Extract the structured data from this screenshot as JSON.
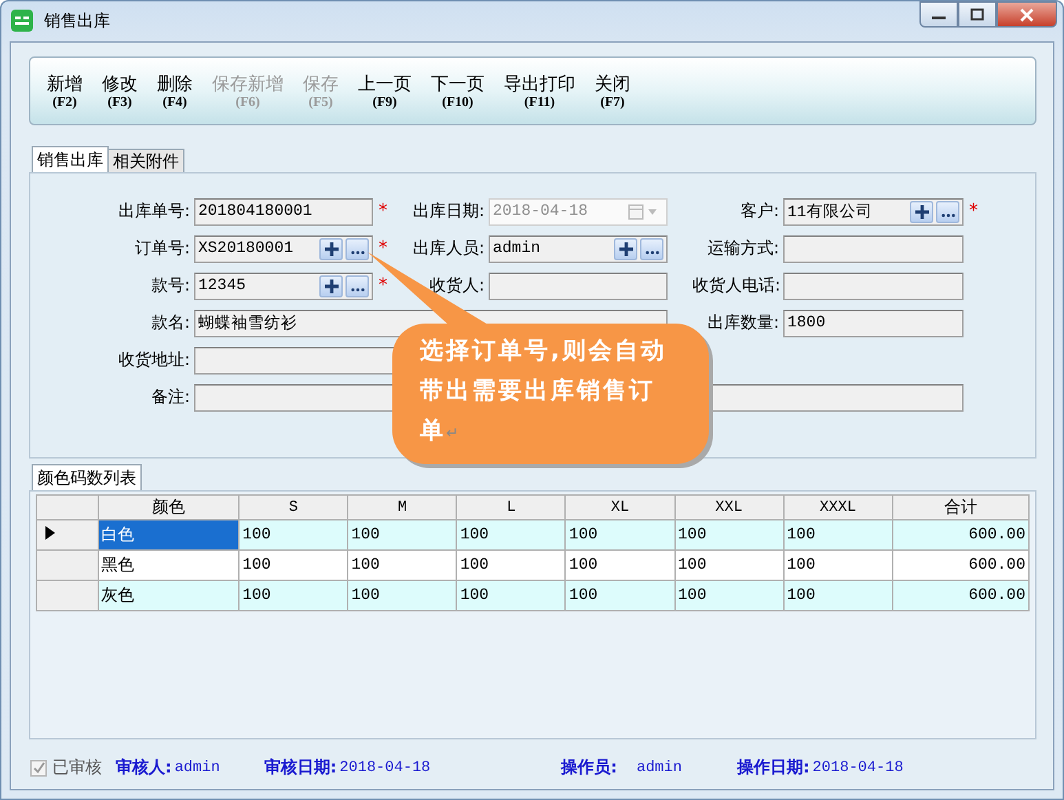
{
  "window": {
    "title": "销售出库"
  },
  "toolbar": [
    {
      "label": "新增",
      "key": "(F2)",
      "disabled": false
    },
    {
      "label": "修改",
      "key": "(F3)",
      "disabled": false
    },
    {
      "label": "删除",
      "key": "(F4)",
      "disabled": false
    },
    {
      "label": "保存新增",
      "key": "(F6)",
      "disabled": true
    },
    {
      "label": "保存",
      "key": "(F5)",
      "disabled": true
    },
    {
      "label": "上一页",
      "key": "(F9)",
      "disabled": false
    },
    {
      "label": "下一页",
      "key": "(F10)",
      "disabled": false
    },
    {
      "label": "导出打印",
      "key": "(F11)",
      "disabled": false
    },
    {
      "label": "关闭",
      "key": "(F7)",
      "disabled": false
    }
  ],
  "tabs": [
    {
      "label": "销售出库",
      "selected": true
    },
    {
      "label": "相关附件",
      "selected": false
    }
  ],
  "form": {
    "required_mark": "*",
    "fields": [
      {
        "label": "出库单号:",
        "value": "201804180001",
        "kind": "text",
        "required": true
      },
      {
        "label": "出库日期:",
        "value": "2018-04-18",
        "kind": "date",
        "required": false
      },
      {
        "label": "客户:",
        "value": "11有限公司",
        "kind": "lookup",
        "required": true
      },
      {
        "label": "订单号:",
        "value": "XS20180001",
        "kind": "lookup",
        "required": true
      },
      {
        "label": "出库人员:",
        "value": "admin",
        "kind": "lookup",
        "required": false
      },
      {
        "label": "运输方式:",
        "kind": "text",
        "required": false
      },
      {
        "label": "款号:",
        "value": "12345",
        "kind": "lookup",
        "required": true
      },
      {
        "label": "收货人:",
        "kind": "text",
        "required": false
      },
      {
        "label": "收货人电话:",
        "kind": "text",
        "required": false
      },
      {
        "label": "款名:",
        "value": "蝴蝶袖雪纺衫",
        "kind": "text",
        "required": false
      },
      {
        "label": "出库数量:",
        "value": "1800",
        "kind": "text",
        "required": false
      },
      {
        "label": "收货地址:",
        "kind": "text",
        "required": false
      },
      {
        "label": "备注:",
        "kind": "text",
        "required": false
      }
    ]
  },
  "callout": {
    "lines": [
      "选择订单号,则会自动",
      "带出需要出库销售订",
      "单"
    ],
    "return_mark": "↵"
  },
  "grid": {
    "tab": "颜色码数列表",
    "columns": [
      "颜色",
      "S",
      "M",
      "L",
      "XL",
      "XXL",
      "XXXL",
      "合计"
    ],
    "rows": [
      {
        "cells": [
          "白色",
          "100",
          "100",
          "100",
          "100",
          "100",
          "100",
          "600.00"
        ],
        "selected": true
      },
      {
        "cells": [
          "黑色",
          "100",
          "100",
          "100",
          "100",
          "100",
          "100",
          "600.00"
        ],
        "selected": false
      },
      {
        "cells": [
          "灰色",
          "100",
          "100",
          "100",
          "100",
          "100",
          "100",
          "600.00"
        ],
        "selected": false
      }
    ]
  },
  "status_bar": {
    "approved": {
      "label": "已审核",
      "checked": true
    },
    "items": [
      {
        "label": "审核人:",
        "value": "admin"
      },
      {
        "label": "审核日期:",
        "value": "2018-04-18"
      },
      {
        "label": "操作员:",
        "value": "admin"
      },
      {
        "label": "操作日期:",
        "value": "2018-04-18"
      }
    ]
  }
}
